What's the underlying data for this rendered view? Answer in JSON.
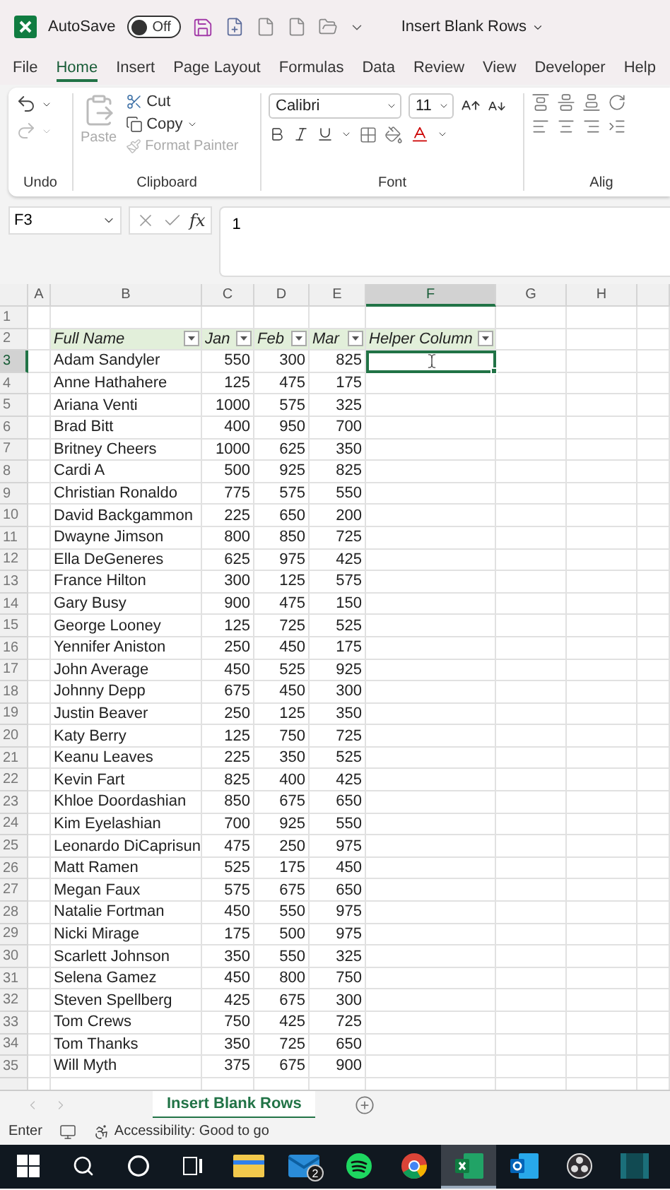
{
  "title_bar": {
    "autosave_label": "AutoSave",
    "autosave": {
      "on": false,
      "label": "Off"
    },
    "document_title": "Insert Blank Rows"
  },
  "menu_tabs": [
    {
      "label": "File",
      "selected": false
    },
    {
      "label": "Home",
      "selected": true
    },
    {
      "label": "Insert",
      "selected": false
    },
    {
      "label": "Page Layout",
      "selected": false
    },
    {
      "label": "Formulas",
      "selected": false
    },
    {
      "label": "Data",
      "selected": false
    },
    {
      "label": "Review",
      "selected": false
    },
    {
      "label": "View",
      "selected": false
    },
    {
      "label": "Developer",
      "selected": false
    },
    {
      "label": "Help",
      "selected": false
    }
  ],
  "ribbon": {
    "undo": {
      "label": "Undo",
      "redo_disabled": true
    },
    "clipboard": {
      "label": "Clipboard",
      "paste": {
        "label": "Paste",
        "disabled": true
      },
      "cut": "Cut",
      "copy": "Copy",
      "format_painter": {
        "label": "Format Painter",
        "disabled": true
      }
    },
    "font": {
      "label": "Font",
      "name": "Calibri",
      "size": "11"
    },
    "alignment": {
      "label": "Alig"
    }
  },
  "formula_bar": {
    "name_box": "F3",
    "function_label": "fx",
    "formula": "1"
  },
  "sheet": {
    "columns": [
      {
        "label": "A",
        "selected": false
      },
      {
        "label": "B",
        "selected": false
      },
      {
        "label": "C",
        "selected": false
      },
      {
        "label": "D",
        "selected": false
      },
      {
        "label": "E",
        "selected": false
      },
      {
        "label": "F",
        "selected": true
      },
      {
        "label": "G",
        "selected": false
      },
      {
        "label": "H",
        "selected": false
      }
    ],
    "empty_row": {
      "number": "1"
    },
    "header_row": {
      "number": "2",
      "labels": [
        "Full Name",
        "Jan",
        "Feb",
        "Mar",
        "Helper Column"
      ]
    },
    "rows": [
      {
        "number": "3",
        "selected": true,
        "name": "Adam Sandyler",
        "jan": "550",
        "feb": "300",
        "mar": "825"
      },
      {
        "number": "4",
        "selected": false,
        "name": "Anne Hathahere",
        "jan": "125",
        "feb": "475",
        "mar": "175"
      },
      {
        "number": "5",
        "selected": false,
        "name": "Ariana Venti",
        "jan": "1000",
        "feb": "575",
        "mar": "325"
      },
      {
        "number": "6",
        "selected": false,
        "name": "Brad Bitt",
        "jan": "400",
        "feb": "950",
        "mar": "700"
      },
      {
        "number": "7",
        "selected": false,
        "name": "Britney Cheers",
        "jan": "1000",
        "feb": "625",
        "mar": "350"
      },
      {
        "number": "8",
        "selected": false,
        "name": "Cardi A",
        "jan": "500",
        "feb": "925",
        "mar": "825"
      },
      {
        "number": "9",
        "selected": false,
        "name": "Christian Ronaldo",
        "jan": "775",
        "feb": "575",
        "mar": "550"
      },
      {
        "number": "10",
        "selected": false,
        "name": "David Backgammon",
        "jan": "225",
        "feb": "650",
        "mar": "200"
      },
      {
        "number": "11",
        "selected": false,
        "name": "Dwayne Jimson",
        "jan": "800",
        "feb": "850",
        "mar": "725"
      },
      {
        "number": "12",
        "selected": false,
        "name": "Ella DeGeneres",
        "jan": "625",
        "feb": "975",
        "mar": "425"
      },
      {
        "number": "13",
        "selected": false,
        "name": "France Hilton",
        "jan": "300",
        "feb": "125",
        "mar": "575"
      },
      {
        "number": "14",
        "selected": false,
        "name": "Gary Busy",
        "jan": "900",
        "feb": "475",
        "mar": "150"
      },
      {
        "number": "15",
        "selected": false,
        "name": "George Looney",
        "jan": "125",
        "feb": "725",
        "mar": "525"
      },
      {
        "number": "16",
        "selected": false,
        "name": "Yennifer Aniston",
        "jan": "250",
        "feb": "450",
        "mar": "175"
      },
      {
        "number": "17",
        "selected": false,
        "name": "John Average",
        "jan": "450",
        "feb": "525",
        "mar": "925"
      },
      {
        "number": "18",
        "selected": false,
        "name": "Johnny Depp",
        "jan": "675",
        "feb": "450",
        "mar": "300"
      },
      {
        "number": "19",
        "selected": false,
        "name": "Justin Beaver",
        "jan": "250",
        "feb": "125",
        "mar": "350"
      },
      {
        "number": "20",
        "selected": false,
        "name": "Katy Berry",
        "jan": "125",
        "feb": "750",
        "mar": "725"
      },
      {
        "number": "21",
        "selected": false,
        "name": "Keanu Leaves",
        "jan": "225",
        "feb": "350",
        "mar": "525"
      },
      {
        "number": "22",
        "selected": false,
        "name": "Kevin Fart",
        "jan": "825",
        "feb": "400",
        "mar": "425"
      },
      {
        "number": "23",
        "selected": false,
        "name": "Khloe Doordashian",
        "jan": "850",
        "feb": "675",
        "mar": "650"
      },
      {
        "number": "24",
        "selected": false,
        "name": "Kim Eyelashian",
        "jan": "700",
        "feb": "925",
        "mar": "550"
      },
      {
        "number": "25",
        "selected": false,
        "name": "Leonardo DiCaprisun",
        "jan": "475",
        "feb": "250",
        "mar": "975"
      },
      {
        "number": "26",
        "selected": false,
        "name": "Matt Ramen",
        "jan": "525",
        "feb": "175",
        "mar": "450"
      },
      {
        "number": "27",
        "selected": false,
        "name": "Megan Faux",
        "jan": "575",
        "feb": "675",
        "mar": "650"
      },
      {
        "number": "28",
        "selected": false,
        "name": "Natalie Fortman",
        "jan": "450",
        "feb": "550",
        "mar": "975"
      },
      {
        "number": "29",
        "selected": false,
        "name": "Nicki Mirage",
        "jan": "175",
        "feb": "500",
        "mar": "975"
      },
      {
        "number": "30",
        "selected": false,
        "name": "Scarlett Johnson",
        "jan": "350",
        "feb": "550",
        "mar": "325"
      },
      {
        "number": "31",
        "selected": false,
        "name": "Selena Gamez",
        "jan": "450",
        "feb": "800",
        "mar": "750"
      },
      {
        "number": "32",
        "selected": false,
        "name": "Steven Spellberg",
        "jan": "425",
        "feb": "675",
        "mar": "300"
      },
      {
        "number": "33",
        "selected": false,
        "name": "Tom Crews",
        "jan": "750",
        "feb": "425",
        "mar": "725"
      },
      {
        "number": "34",
        "selected": false,
        "name": "Tom Thanks",
        "jan": "350",
        "feb": "725",
        "mar": "650"
      },
      {
        "number": "35",
        "selected": false,
        "name": "Will Myth",
        "jan": "375",
        "feb": "675",
        "mar": "900"
      }
    ]
  },
  "sheet_tabs": [
    {
      "label": "Insert Blank Rows",
      "selected": true
    }
  ],
  "status_bar": {
    "mode": "Enter",
    "accessibility": "Accessibility: Good to go"
  },
  "taskbar": [
    {
      "kind": "start",
      "active": false
    },
    {
      "kind": "search",
      "active": false
    },
    {
      "kind": "cortana",
      "active": false
    },
    {
      "kind": "taskview",
      "active": false
    },
    {
      "kind": "explorer",
      "active": false
    },
    {
      "kind": "mail",
      "active": false,
      "badge": "2"
    },
    {
      "kind": "spotify",
      "active": false
    },
    {
      "kind": "chrome",
      "active": false
    },
    {
      "kind": "excel",
      "active": true
    },
    {
      "kind": "outlook",
      "active": false
    },
    {
      "kind": "obs",
      "active": false
    },
    {
      "kind": "panel",
      "active": false
    }
  ]
}
